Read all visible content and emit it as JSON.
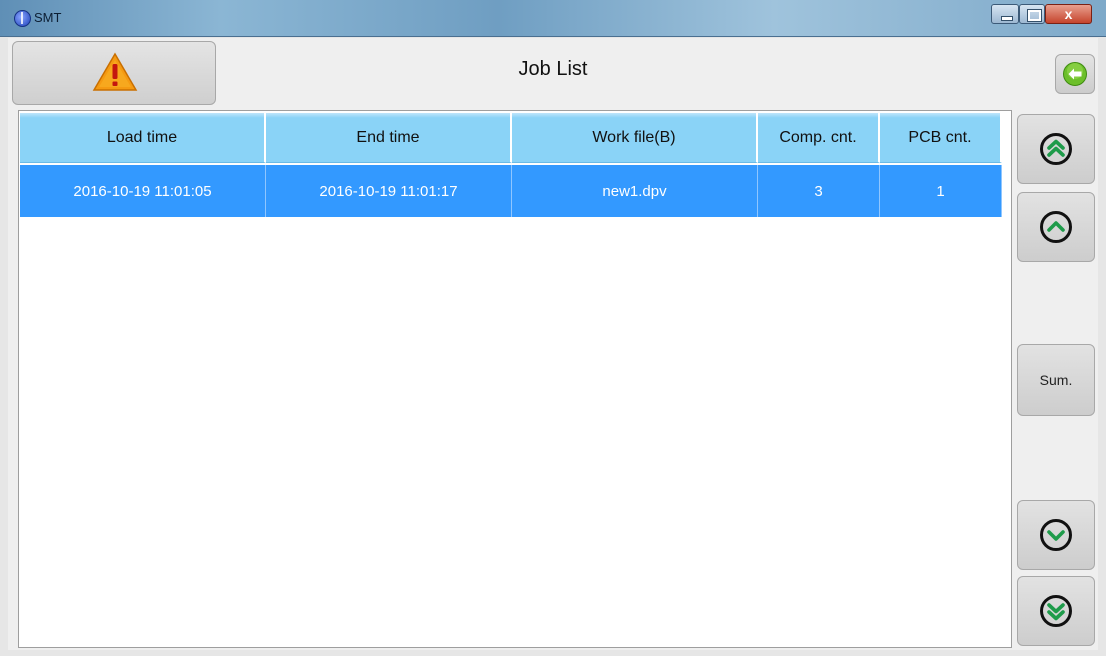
{
  "window": {
    "title": "SMT"
  },
  "header": {
    "title": "Job List",
    "alarm_icon": "warning-icon",
    "back_icon": "back-arrow-icon"
  },
  "table": {
    "columns": [
      "Load time",
      "End time",
      "Work file(B)",
      "Comp. cnt.",
      "PCB cnt."
    ],
    "rows": [
      [
        "2016-10-19 11:01:05",
        "2016-10-19 11:01:17",
        "new1.dpv",
        "3",
        "1"
      ]
    ],
    "selected_row": 0
  },
  "side_buttons": {
    "top_label": "first-page-icon",
    "up_label": "page-up-icon",
    "sum_label": "Sum.",
    "down_label": "page-down-icon",
    "bottom_label": "last-page-icon"
  },
  "colors": {
    "header_blue": "#8ad3f7",
    "selected_row": "#3399ff",
    "accent_green": "#1e9b4a"
  }
}
